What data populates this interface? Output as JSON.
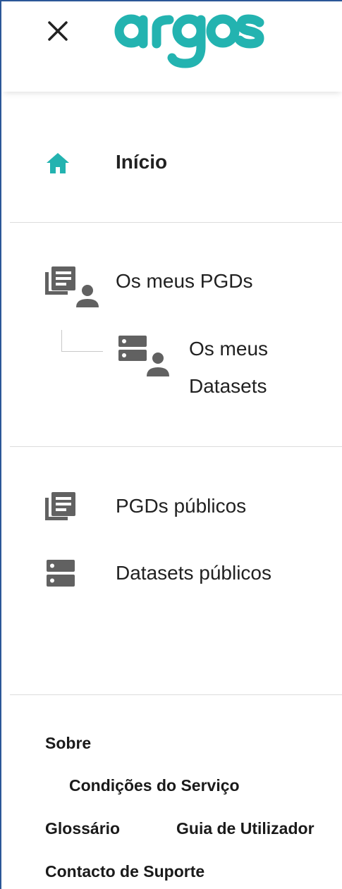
{
  "header": {
    "logo_text": "argos",
    "close_icon": "close-icon",
    "brand_color": "#23b3b0"
  },
  "nav": {
    "home": {
      "label": "Início",
      "icon": "home-icon",
      "icon_color": "#23b3b0"
    },
    "my_pgds": {
      "label": "Os meus PGDs",
      "icon": "my-pgds-icon"
    },
    "my_datasets": {
      "label_line1": "Os meus",
      "label_line2": "Datasets",
      "icon": "my-datasets-icon"
    },
    "public_pgds": {
      "label": "PGDs públicos",
      "icon": "public-pgds-icon"
    },
    "public_datasets": {
      "label": "Datasets públicos",
      "icon": "public-datasets-icon"
    }
  },
  "footer": {
    "about": "Sobre",
    "terms": "Condições do Serviço",
    "glossary": "Glossário",
    "user_guide": "Guia de Utilizador",
    "support": "Contacto de Suporte"
  },
  "colors": {
    "icon_gray": "#616161",
    "text": "#212121",
    "divider": "#dcdcdc",
    "frame_border": "#2b5797"
  }
}
